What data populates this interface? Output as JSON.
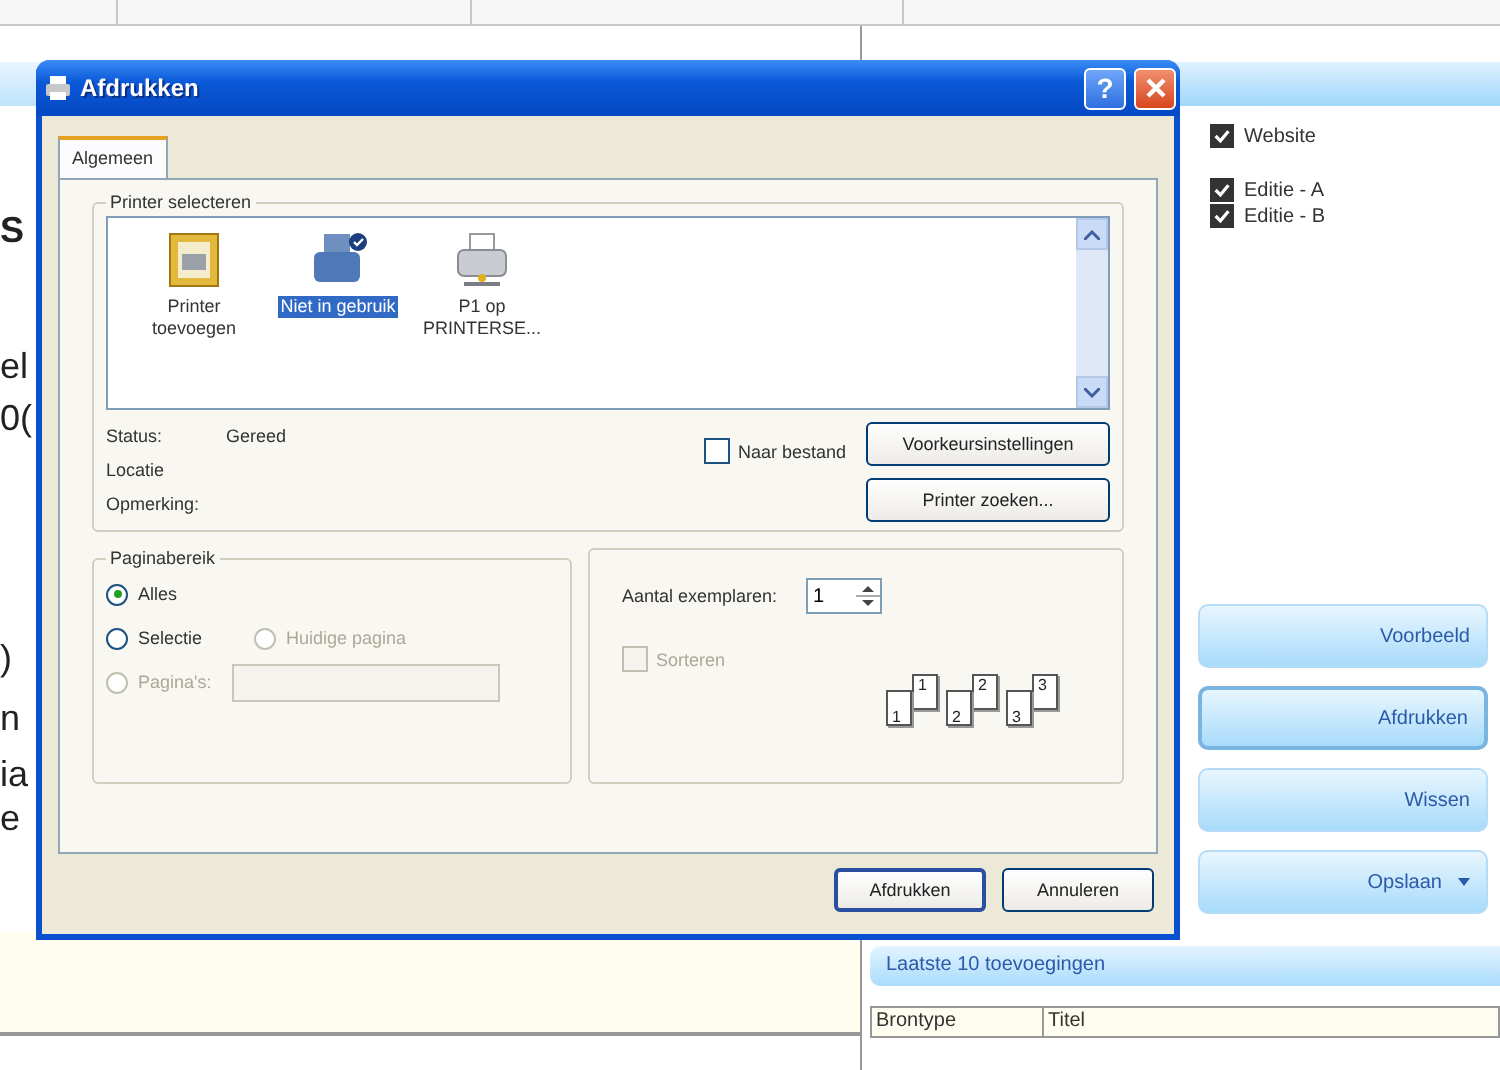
{
  "app": {
    "left_fragments": [
      "S",
      "el",
      "0(",
      ")",
      "n",
      "ia",
      "e"
    ],
    "options": [
      {
        "label": "Website",
        "checked": true
      },
      {
        "label": "Editie - A",
        "checked": true
      },
      {
        "label": "Editie - B",
        "checked": true
      }
    ],
    "actions": [
      {
        "label": "Voorbeeld",
        "selected": false,
        "dropdown": false
      },
      {
        "label": "Afdrukken",
        "selected": true,
        "dropdown": false
      },
      {
        "label": "Wissen",
        "selected": false,
        "dropdown": false
      },
      {
        "label": "Opslaan",
        "selected": false,
        "dropdown": true
      }
    ],
    "recent": {
      "title": "Laatste 10 toevoegingen",
      "columns": [
        "Brontype",
        "Titel"
      ]
    }
  },
  "dialog": {
    "title": "Afdrukken",
    "help": "?",
    "tabs": [
      {
        "label": "Algemeen",
        "selected": true
      }
    ],
    "printer_group": "Printer selecteren",
    "printers": [
      {
        "label": "Printer toevoegen",
        "kind": "add",
        "selected": false
      },
      {
        "label": "Niet in gebruik",
        "kind": "default",
        "selected": true
      },
      {
        "label": "P1 op PRINTERSE...",
        "kind": "network",
        "selected": false
      }
    ],
    "info": [
      {
        "label": "Status:",
        "value": "Gereed"
      },
      {
        "label": "Locatie"
      },
      {
        "label": "Opmerking:"
      }
    ],
    "print_to_file": {
      "label": "Naar bestand",
      "checked": false
    },
    "side_buttons": [
      "Voorkeursinstellingen",
      "Printer zoeken..."
    ],
    "range": {
      "title": "Paginabereik",
      "options": [
        {
          "label": "Alles",
          "selected": true,
          "disabled": false
        },
        {
          "label": "Selectie",
          "selected": false,
          "disabled": false
        },
        {
          "label": "Huidige pagina",
          "selected": false,
          "disabled": true
        },
        {
          "label": "Pagina's:",
          "selected": false,
          "disabled": true
        }
      ]
    },
    "copies": {
      "label": "Aantal exemplaren:",
      "value": "1",
      "collate": {
        "label": "Sorteren",
        "checked": false,
        "disabled": true
      },
      "pages": [
        {
          "back": "1",
          "front": "1"
        },
        {
          "back": "2",
          "front": "2"
        },
        {
          "back": "3",
          "front": "3"
        }
      ]
    },
    "buttons": [
      {
        "label": "Afdrukken",
        "default": true
      },
      {
        "label": "Annuleren",
        "default": false
      }
    ]
  }
}
